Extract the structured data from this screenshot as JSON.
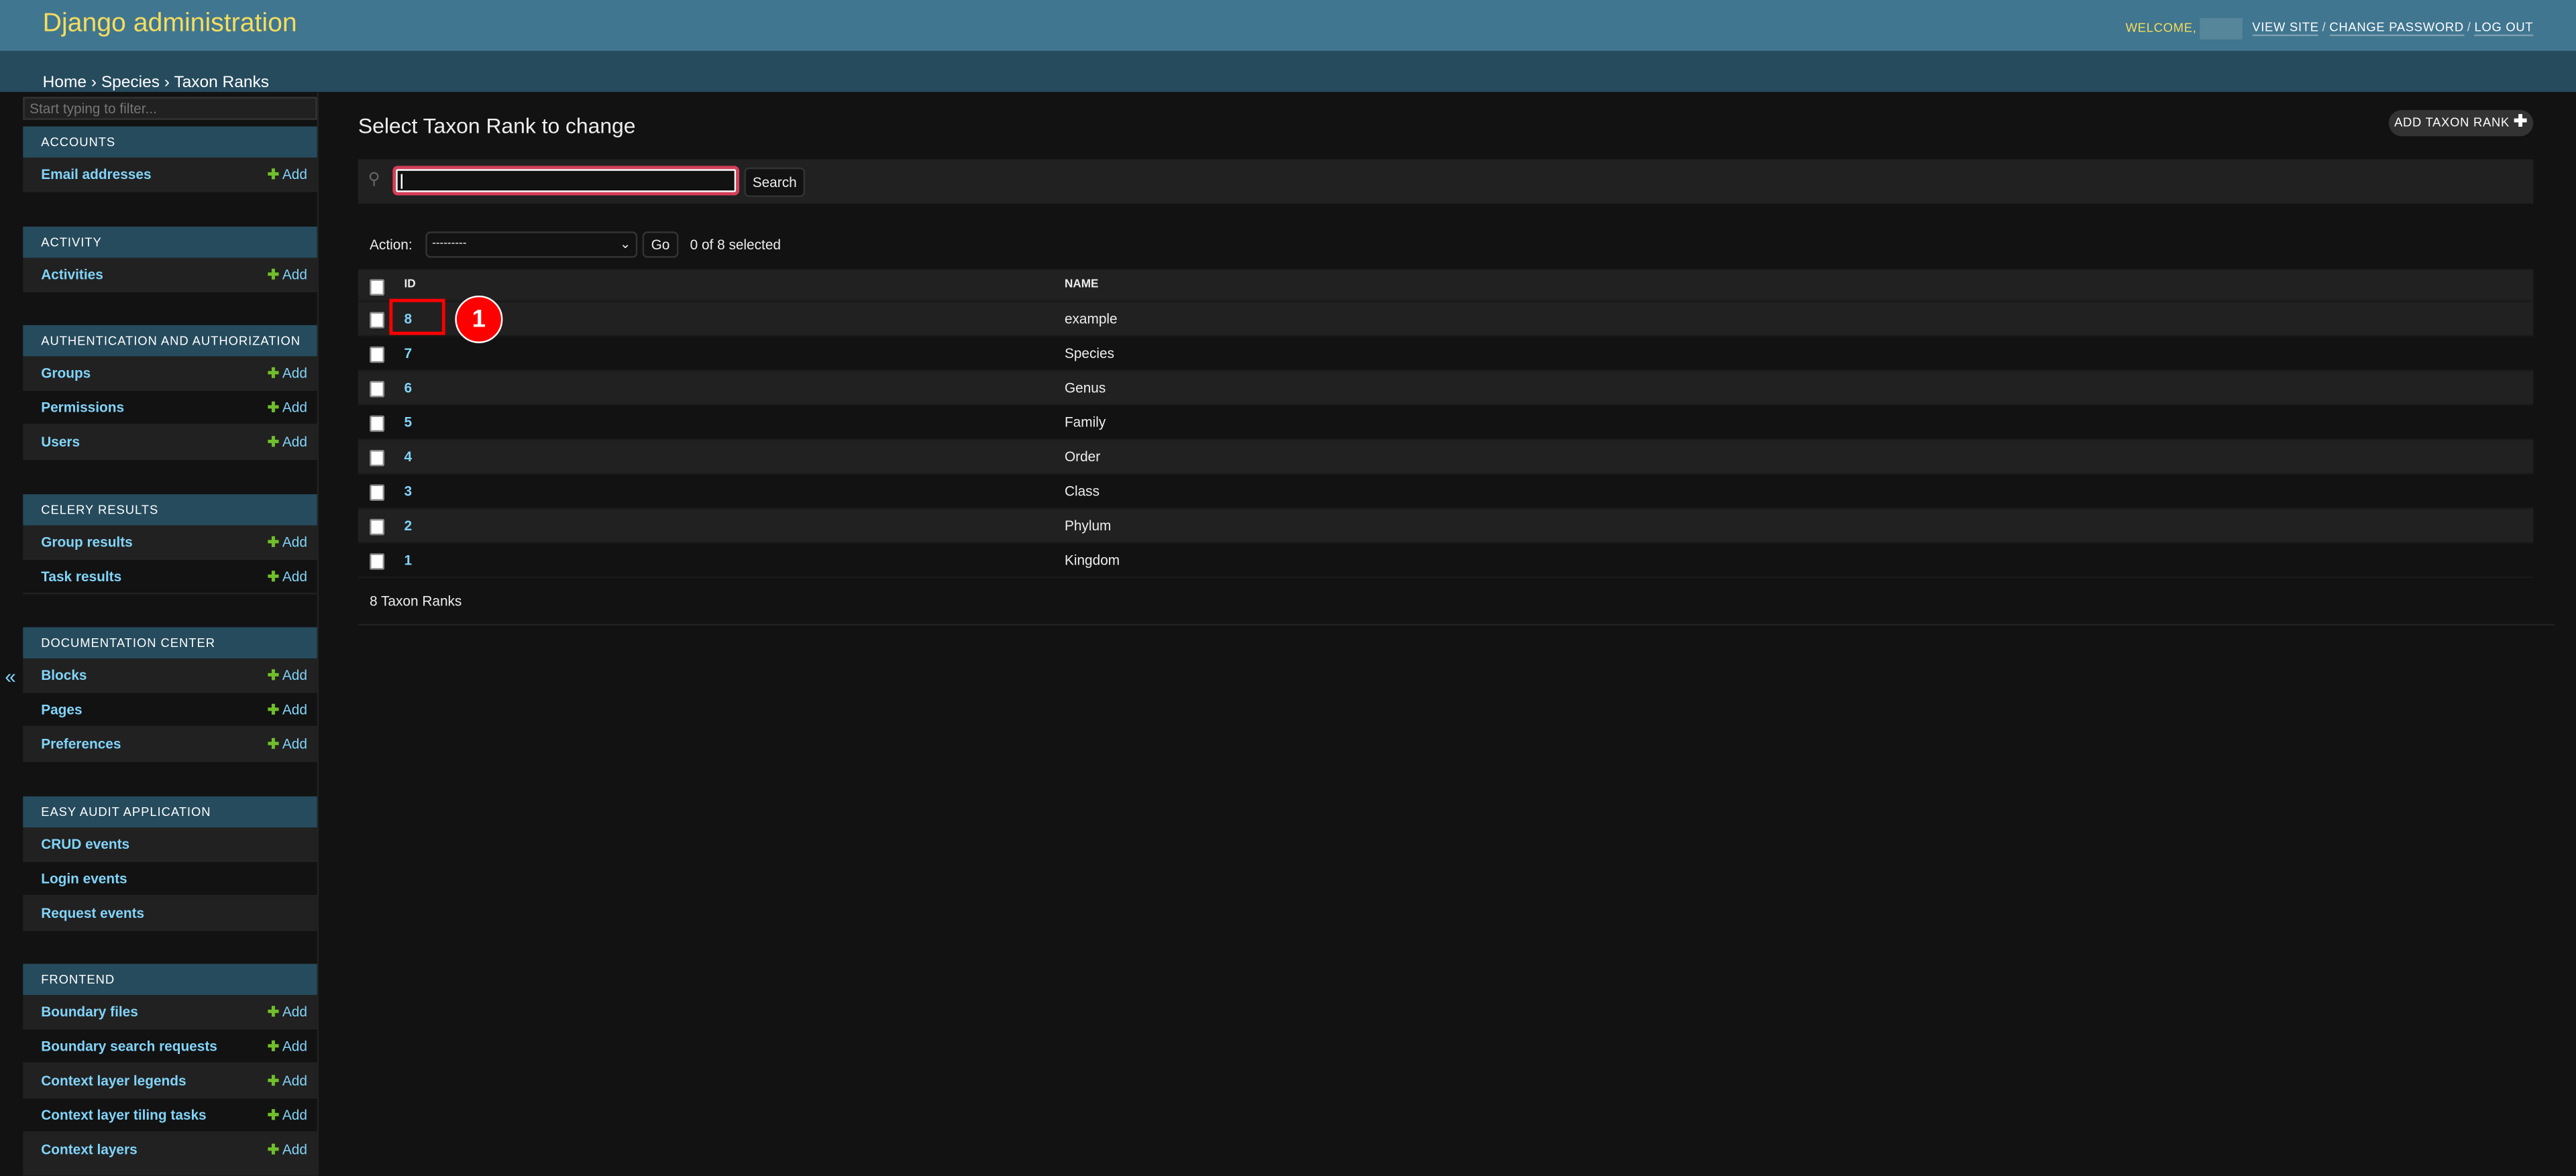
{
  "header": {
    "brand": "Django administration",
    "welcome": "WELCOME,",
    "links": [
      "VIEW SITE",
      "CHANGE PASSWORD",
      "LOG OUT"
    ],
    "separator": "/"
  },
  "breadcrumbs": [
    "Home",
    "Species",
    "Taxon Ranks"
  ],
  "breadcrumb_sep": "›",
  "sidebar": {
    "filter_placeholder": "Start typing to filter...",
    "add_label": "Add",
    "collapse_icon": "«",
    "sections": [
      {
        "title": "ACCOUNTS",
        "items": [
          {
            "label": "Email addresses",
            "add": true
          }
        ]
      },
      {
        "title": "ACTIVITY",
        "items": [
          {
            "label": "Activities",
            "add": true
          }
        ]
      },
      {
        "title": "AUTHENTICATION AND AUTHORIZATION",
        "items": [
          {
            "label": "Groups",
            "add": true
          },
          {
            "label": "Permissions",
            "add": true
          },
          {
            "label": "Users",
            "add": true
          }
        ]
      },
      {
        "title": "CELERY RESULTS",
        "items": [
          {
            "label": "Group results",
            "add": true
          },
          {
            "label": "Task results",
            "add": true
          }
        ]
      },
      {
        "title": "DOCUMENTATION CENTER",
        "items": [
          {
            "label": "Blocks",
            "add": true
          },
          {
            "label": "Pages",
            "add": true
          },
          {
            "label": "Preferences",
            "add": true
          }
        ]
      },
      {
        "title": "EASY AUDIT APPLICATION",
        "items": [
          {
            "label": "CRUD events",
            "add": false
          },
          {
            "label": "Login events",
            "add": false
          },
          {
            "label": "Request events",
            "add": false
          }
        ]
      },
      {
        "title": "FRONTEND",
        "items": [
          {
            "label": "Boundary files",
            "add": true
          },
          {
            "label": "Boundary search requests",
            "add": true
          },
          {
            "label": "Context layer legends",
            "add": true
          },
          {
            "label": "Context layer tiling tasks",
            "add": true
          },
          {
            "label": "Context layers",
            "add": true
          }
        ]
      }
    ]
  },
  "main": {
    "title": "Select Taxon Rank to change",
    "add_button": "ADD TAXON RANK",
    "search": {
      "value": "",
      "button": "Search"
    },
    "actions": {
      "label": "Action:",
      "selected": "---------",
      "go": "Go",
      "count": "0 of 8 selected"
    },
    "table": {
      "columns": [
        "ID",
        "NAME"
      ],
      "rows": [
        [
          "8",
          "example"
        ],
        [
          "7",
          "Species"
        ],
        [
          "6",
          "Genus"
        ],
        [
          "5",
          "Family"
        ],
        [
          "4",
          "Order"
        ],
        [
          "3",
          "Class"
        ],
        [
          "2",
          "Phylum"
        ],
        [
          "1",
          "Kingdom"
        ]
      ]
    },
    "footer": "8 Taxon Ranks"
  },
  "annotation": {
    "label": "1",
    "color": "#ff0000"
  },
  "colors": {
    "header": "#417690",
    "breadcrumbs": "#264b5d",
    "brand": "#f5dd5d",
    "link": "#81d4fa",
    "add": "#70bf2b",
    "background": "#121212"
  }
}
